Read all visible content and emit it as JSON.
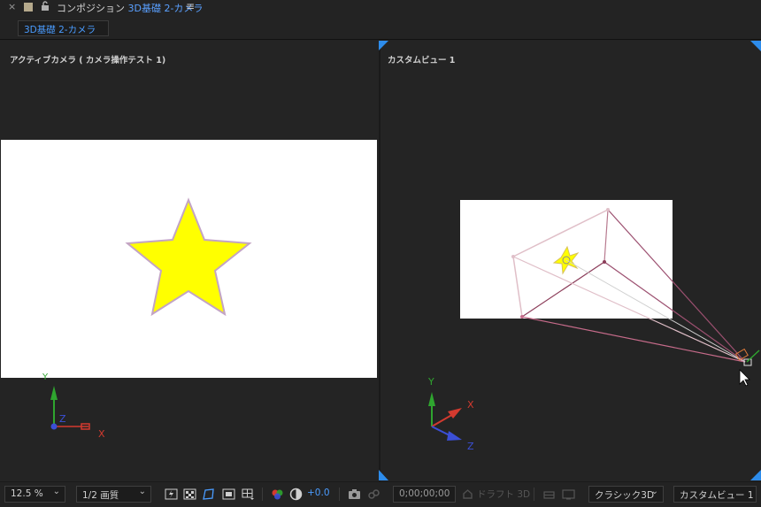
{
  "panel": {
    "close_glyph": "×",
    "title_prefix": "コンポジション",
    "comp_name": "3D基礎 2-カメラ",
    "menu_glyph": "≡",
    "subtab_label": "3D基礎 2-カメラ"
  },
  "viewers": {
    "left_label": "アクティブカメラ ( カメラ操作テスト 1)",
    "right_label": "カスタムビュー 1"
  },
  "axes": {
    "x": "X",
    "y": "Y",
    "z": "Z"
  },
  "toolbar": {
    "zoom": "12.5 %",
    "resolution": "1/2 画質",
    "exposure": "+0.0",
    "timecode": "0;00;00;00",
    "draft3d": "ドラフト 3D",
    "renderer": "クラシック3D",
    "view": "カスタムビュー 1"
  },
  "colors": {
    "accent": "#4a9cff",
    "star_fill": "#ffff00",
    "axis_x": "#d33a2f",
    "axis_y": "#2fa52f",
    "axis_z": "#3b4fd6"
  },
  "icons": [
    "lock-icon",
    "region-of-interest-icon",
    "transparency-grid-icon",
    "mask-path-icon",
    "guide-icon",
    "channel-icon",
    "exposure-reset-icon",
    "snapshot-icon",
    "show-snapshot-icon",
    "draft-3d-icon",
    "view-layout-icon"
  ]
}
